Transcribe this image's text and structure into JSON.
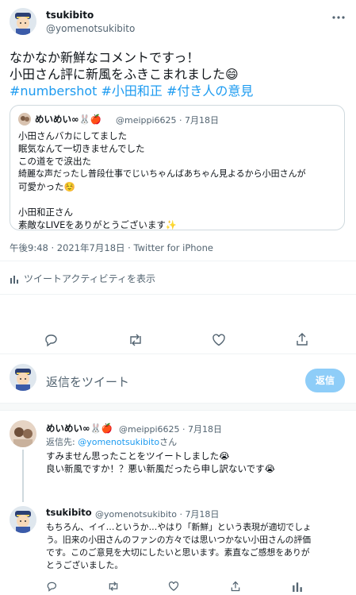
{
  "tweet": {
    "author_name": "tsukibito",
    "author_handle": "@yomenotsukibito",
    "text_lines": [
      "なかなか新鮮なコメントですっ！",
      "小田さん評に新風をふきこまれました😄"
    ],
    "hashtags": "#numbershot #小田和正 #付き人の意見",
    "meta": "午後9:48 · 2021年7月18日 · Twitter for iPhone",
    "activity_label": "ツイートアクティビティを表示"
  },
  "quote": {
    "author_name": "めいめい∞🐰🍎",
    "author_handle": "@meippi6625 · 7月18日",
    "lines": [
      "小田さんバカにしてました",
      "眠気なんて一切きませんでした",
      "この道をで涙出た",
      "綺麗な声だったし普段仕事でじいちゃんばあちゃん見よるから小田さんが",
      "可愛かった☺️",
      "",
      "小田和正さん",
      "素敵なLIVEをありがとうございます✨"
    ]
  },
  "reply_box": {
    "placeholder": "返信をツイート",
    "button": "返信"
  },
  "reply1": {
    "author_name": "めいめい∞🐰🍎",
    "meta": "@meippi6625 · 7月18日",
    "reply_to_prefix": "返信先: ",
    "reply_to_handle": "@yomenotsukibito",
    "reply_to_suffix": "さん",
    "lines": [
      "すみません思ったことをツイートしました😭",
      "良い新風ですか！？悪い新風だったら申し訳ないです😭"
    ]
  },
  "reply2": {
    "author_name": "tsukibito",
    "meta": "@yomenotsukibito · 7月18日",
    "lines": [
      "もちろん、イイ…というか…やはり「新鮮」という表現が適切でしょ",
      "う。旧来の小田さんのファンの方々では思いつかない小田さんの評価",
      "です。このご意見を大切にしたいと思います。素直なご感想をありが",
      "とうございました。"
    ]
  },
  "colors": {
    "accent": "#1d9bf0",
    "reply_button_disabled": "#8ecdf8",
    "muted": "#536471",
    "border": "#cfd9de"
  }
}
